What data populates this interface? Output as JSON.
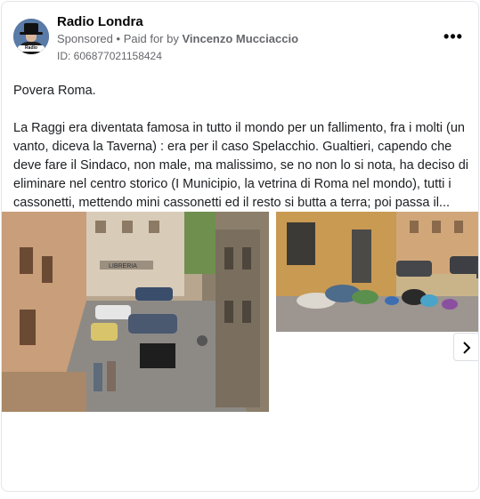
{
  "post": {
    "page_name": "Radio Londra",
    "sponsored_label": "Sponsored",
    "separator": "•",
    "paid_for_label": "Paid for by",
    "payer": "Vincenzo Mucciaccio",
    "ad_id": "ID: 606877021158424",
    "avatar_badge": "Radio Londra",
    "more_icon": "more-horizontal-icon",
    "more_label": "•••",
    "text_line1": "Povera Roma.",
    "text_line2": "La Raggi era diventata famosa in tutto il mondo per un fallimento, fra i molti (un vanto, diceva la Taverna) : era per il caso Spelacchio. Gualtieri, capendo che deve fare il Sindaco, non male, ma malissimo, se no non lo si nota, ha deciso di eliminare nel centro storico (I Municipio, la vetrina di Roma nel mondo), tutti i cassonetti, mettendo mini cassonetti ed il resto si butta a terra; poi passa il...",
    "image1_shop_sign": "LIBRERIA",
    "next_icon": "chevron-right-icon"
  },
  "colors": {
    "text_primary": "#050505",
    "text_secondary": "#65676b",
    "border": "#e4e6eb"
  }
}
